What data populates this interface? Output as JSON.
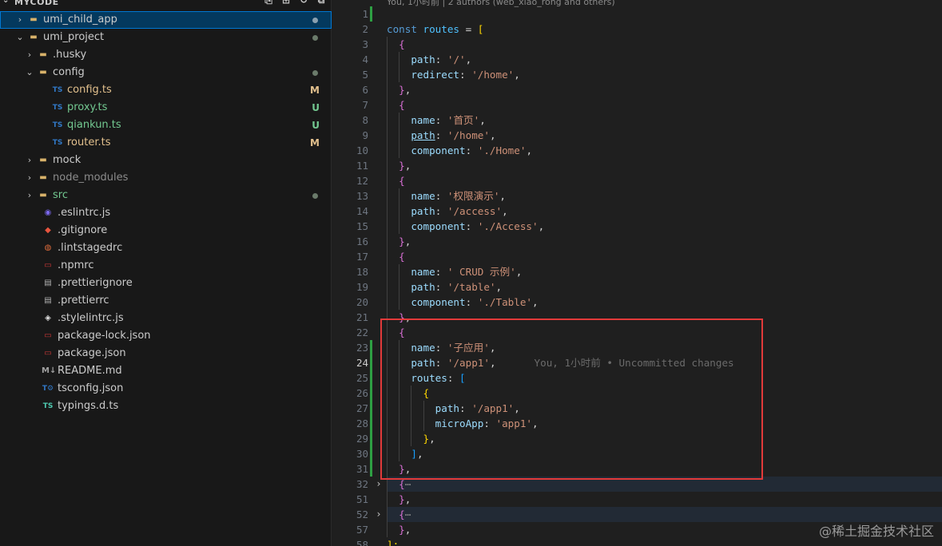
{
  "explorer": {
    "root_title": "MYCODE",
    "actions": [
      "new-file-icon",
      "new-folder-icon",
      "refresh-icon",
      "collapse-icon"
    ],
    "items": [
      {
        "label": "umi_child_app",
        "depth": 0,
        "kind": "folder",
        "expanded": false,
        "selected": true,
        "decor": "dot",
        "color": "white"
      },
      {
        "label": "umi_project",
        "depth": 0,
        "kind": "folder",
        "expanded": true,
        "decor": "dot",
        "color": "white"
      },
      {
        "label": ".husky",
        "depth": 1,
        "kind": "folder",
        "expanded": false,
        "color": "white"
      },
      {
        "label": "config",
        "depth": 1,
        "kind": "folder",
        "expanded": true,
        "decor": "dot",
        "color": "white"
      },
      {
        "label": "config.ts",
        "depth": 2,
        "kind": "ts",
        "badge": "M",
        "color": "yellow"
      },
      {
        "label": "proxy.ts",
        "depth": 2,
        "kind": "ts",
        "badge": "U",
        "color": "green"
      },
      {
        "label": "qiankun.ts",
        "depth": 2,
        "kind": "ts",
        "badge": "U",
        "color": "green"
      },
      {
        "label": "router.ts",
        "depth": 2,
        "kind": "ts",
        "badge": "M",
        "color": "yellow"
      },
      {
        "label": "mock",
        "depth": 1,
        "kind": "folder",
        "expanded": false,
        "color": "white"
      },
      {
        "label": "node_modules",
        "depth": 1,
        "kind": "folder",
        "expanded": false,
        "color": "gray"
      },
      {
        "label": "src",
        "depth": 1,
        "kind": "folder",
        "expanded": false,
        "decor": "dot",
        "color": "green"
      },
      {
        "label": ".eslintrc.js",
        "depth": 1,
        "kind": "eslint",
        "color": "white"
      },
      {
        "label": ".gitignore",
        "depth": 1,
        "kind": "git",
        "color": "white"
      },
      {
        "label": ".lintstagedrc",
        "depth": 1,
        "kind": "lint",
        "color": "white"
      },
      {
        "label": ".npmrc",
        "depth": 1,
        "kind": "npm",
        "color": "white"
      },
      {
        "label": ".prettierignore",
        "depth": 1,
        "kind": "prettier",
        "color": "white"
      },
      {
        "label": ".prettierrc",
        "depth": 1,
        "kind": "prettier",
        "color": "white"
      },
      {
        "label": ".stylelintrc.js",
        "depth": 1,
        "kind": "stylelint",
        "color": "white"
      },
      {
        "label": "package-lock.json",
        "depth": 1,
        "kind": "npm",
        "color": "white"
      },
      {
        "label": "package.json",
        "depth": 1,
        "kind": "npm",
        "color": "white"
      },
      {
        "label": "README.md",
        "depth": 1,
        "kind": "md",
        "color": "white"
      },
      {
        "label": "tsconfig.json",
        "depth": 1,
        "kind": "tsconfig",
        "color": "white"
      },
      {
        "label": "typings.d.ts",
        "depth": 1,
        "kind": "dts",
        "color": "white"
      }
    ]
  },
  "editor": {
    "codelens": "You, 1小时前 | 2 authors (web_xiao_rong and others)",
    "inline_blame": "You, 1小时前 • Uncommitted changes",
    "active_line": 24,
    "lines": [
      {
        "n": 1,
        "i": 0,
        "t": []
      },
      {
        "n": 2,
        "i": 0,
        "t": [
          [
            "const ",
            "kw"
          ],
          [
            "routes",
            "var"
          ],
          [
            " = ",
            "pun"
          ],
          [
            "[",
            "b1"
          ]
        ]
      },
      {
        "n": 3,
        "i": 1,
        "t": [
          [
            "{",
            "b2"
          ]
        ]
      },
      {
        "n": 4,
        "i": 2,
        "t": [
          [
            "path",
            "prop"
          ],
          [
            ": ",
            "pun"
          ],
          [
            "'/'",
            "str"
          ],
          [
            ",",
            "pun"
          ]
        ]
      },
      {
        "n": 5,
        "i": 2,
        "t": [
          [
            "redirect",
            "prop"
          ],
          [
            ": ",
            "pun"
          ],
          [
            "'/home'",
            "str"
          ],
          [
            ",",
            "pun"
          ]
        ]
      },
      {
        "n": 6,
        "i": 1,
        "t": [
          [
            "}",
            "b2"
          ],
          [
            ",",
            "pun"
          ]
        ]
      },
      {
        "n": 7,
        "i": 1,
        "t": [
          [
            "{",
            "b2"
          ]
        ]
      },
      {
        "n": 8,
        "i": 2,
        "t": [
          [
            "name",
            "prop"
          ],
          [
            ": ",
            "pun"
          ],
          [
            "'首页'",
            "str"
          ],
          [
            ",",
            "pun"
          ]
        ]
      },
      {
        "n": 9,
        "i": 2,
        "t": [
          [
            "path",
            "prop ul"
          ],
          [
            ": ",
            "pun"
          ],
          [
            "'/home'",
            "str"
          ],
          [
            ",",
            "pun"
          ]
        ]
      },
      {
        "n": 10,
        "i": 2,
        "t": [
          [
            "component",
            "prop"
          ],
          [
            ": ",
            "pun"
          ],
          [
            "'./Home'",
            "str"
          ],
          [
            ",",
            "pun"
          ]
        ]
      },
      {
        "n": 11,
        "i": 1,
        "t": [
          [
            "}",
            "b2"
          ],
          [
            ",",
            "pun"
          ]
        ]
      },
      {
        "n": 12,
        "i": 1,
        "t": [
          [
            "{",
            "b2"
          ]
        ]
      },
      {
        "n": 13,
        "i": 2,
        "t": [
          [
            "name",
            "prop"
          ],
          [
            ": ",
            "pun"
          ],
          [
            "'权限演示'",
            "str"
          ],
          [
            ",",
            "pun"
          ]
        ]
      },
      {
        "n": 14,
        "i": 2,
        "t": [
          [
            "path",
            "prop"
          ],
          [
            ": ",
            "pun"
          ],
          [
            "'/access'",
            "str"
          ],
          [
            ",",
            "pun"
          ]
        ]
      },
      {
        "n": 15,
        "i": 2,
        "t": [
          [
            "component",
            "prop"
          ],
          [
            ": ",
            "pun"
          ],
          [
            "'./Access'",
            "str"
          ],
          [
            ",",
            "pun"
          ]
        ]
      },
      {
        "n": 16,
        "i": 1,
        "t": [
          [
            "}",
            "b2"
          ],
          [
            ",",
            "pun"
          ]
        ]
      },
      {
        "n": 17,
        "i": 1,
        "t": [
          [
            "{",
            "b2"
          ]
        ]
      },
      {
        "n": 18,
        "i": 2,
        "t": [
          [
            "name",
            "prop"
          ],
          [
            ": ",
            "pun"
          ],
          [
            "' CRUD 示例'",
            "str"
          ],
          [
            ",",
            "pun"
          ]
        ]
      },
      {
        "n": 19,
        "i": 2,
        "t": [
          [
            "path",
            "prop"
          ],
          [
            ": ",
            "pun"
          ],
          [
            "'/table'",
            "str"
          ],
          [
            ",",
            "pun"
          ]
        ]
      },
      {
        "n": 20,
        "i": 2,
        "t": [
          [
            "component",
            "prop"
          ],
          [
            ": ",
            "pun"
          ],
          [
            "'./Table'",
            "str"
          ],
          [
            ",",
            "pun"
          ]
        ]
      },
      {
        "n": 21,
        "i": 1,
        "t": [
          [
            "}",
            "b2"
          ],
          [
            ",",
            "pun"
          ]
        ]
      },
      {
        "n": 22,
        "i": 1,
        "t": [
          [
            "{",
            "b2"
          ]
        ]
      },
      {
        "n": 23,
        "i": 2,
        "t": [
          [
            "name",
            "prop"
          ],
          [
            ": ",
            "pun"
          ],
          [
            "'子应用'",
            "str"
          ],
          [
            ",",
            "pun"
          ]
        ]
      },
      {
        "n": 24,
        "i": 2,
        "t": [
          [
            "path",
            "prop"
          ],
          [
            ": ",
            "pun"
          ],
          [
            "'/app1'",
            "str"
          ],
          [
            ",",
            "pun"
          ]
        ],
        "blame": true
      },
      {
        "n": 25,
        "i": 2,
        "t": [
          [
            "routes",
            "prop"
          ],
          [
            ": ",
            "pun"
          ],
          [
            "[",
            "b3"
          ]
        ]
      },
      {
        "n": 26,
        "i": 3,
        "t": [
          [
            "{",
            "b1"
          ]
        ]
      },
      {
        "n": 27,
        "i": 4,
        "t": [
          [
            "path",
            "prop"
          ],
          [
            ": ",
            "pun"
          ],
          [
            "'/app1'",
            "str"
          ],
          [
            ",",
            "pun"
          ]
        ]
      },
      {
        "n": 28,
        "i": 4,
        "t": [
          [
            "microApp",
            "prop"
          ],
          [
            ": ",
            "pun"
          ],
          [
            "'app1'",
            "str"
          ],
          [
            ",",
            "pun"
          ]
        ]
      },
      {
        "n": 29,
        "i": 3,
        "t": [
          [
            "}",
            "b1"
          ],
          [
            ",",
            "pun"
          ]
        ]
      },
      {
        "n": 30,
        "i": 2,
        "t": [
          [
            "]",
            "b3"
          ],
          [
            ",",
            "pun"
          ]
        ]
      },
      {
        "n": 31,
        "i": 1,
        "t": [
          [
            "}",
            "b2"
          ],
          [
            ",",
            "pun"
          ]
        ]
      },
      {
        "n": 32,
        "i": 1,
        "t": [
          [
            "{",
            "b2"
          ],
          [
            "⋯",
            "fold-ph"
          ]
        ],
        "fold": true,
        "hl": true
      },
      {
        "n": 51,
        "i": 1,
        "t": [
          [
            "}",
            "b2"
          ],
          [
            ",",
            "pun"
          ]
        ]
      },
      {
        "n": 52,
        "i": 1,
        "t": [
          [
            "{",
            "b2"
          ],
          [
            "⋯",
            "fold-ph"
          ]
        ],
        "fold": true,
        "hl": true
      },
      {
        "n": 57,
        "i": 1,
        "t": [
          [
            "}",
            "b2"
          ],
          [
            ",",
            "pun"
          ]
        ]
      },
      {
        "n": 58,
        "i": 0,
        "t": [
          [
            "];",
            "b1"
          ]
        ]
      }
    ]
  },
  "watermark": "@稀土掘金技术社区",
  "colors": {
    "accent": "#0078d4",
    "highlight_box": "#e23a3a",
    "modified_bar": "#2ea043"
  }
}
